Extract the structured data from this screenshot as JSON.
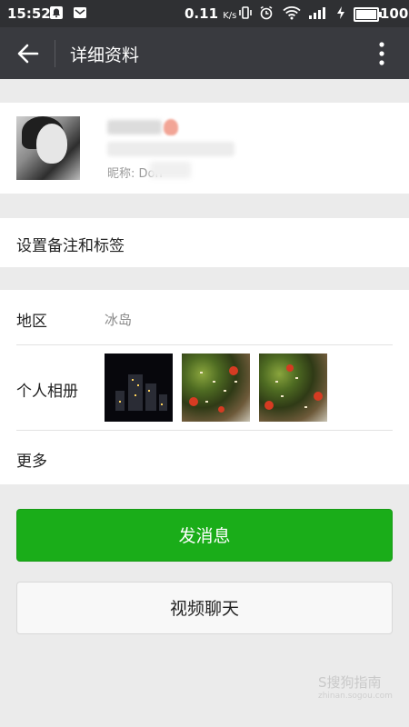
{
  "status_bar": {
    "time": "15:52",
    "network_speed": "0.11",
    "network_unit": "K/s",
    "battery": "100"
  },
  "app_bar": {
    "title": "详细资料",
    "back_icon": "arrow-left-icon",
    "more_icon": "more-vertical-icon"
  },
  "profile": {
    "nickname_label": "昵称: Don"
  },
  "menu": {
    "tags_label": "设置备注和标签"
  },
  "info": {
    "region_label": "地区",
    "region_value": "冰岛",
    "album_label": "个人相册",
    "more_label": "更多"
  },
  "actions": {
    "send_message": "发消息",
    "video_chat": "视频聊天"
  },
  "colors": {
    "status_bar": "#2f3033",
    "app_bar": "#393a3f",
    "primary_button": "#1aad19",
    "page_bg": "#ebebeb"
  },
  "watermark": {
    "text": "S搜狗指南",
    "sub": "zhinan.sogou.com"
  }
}
